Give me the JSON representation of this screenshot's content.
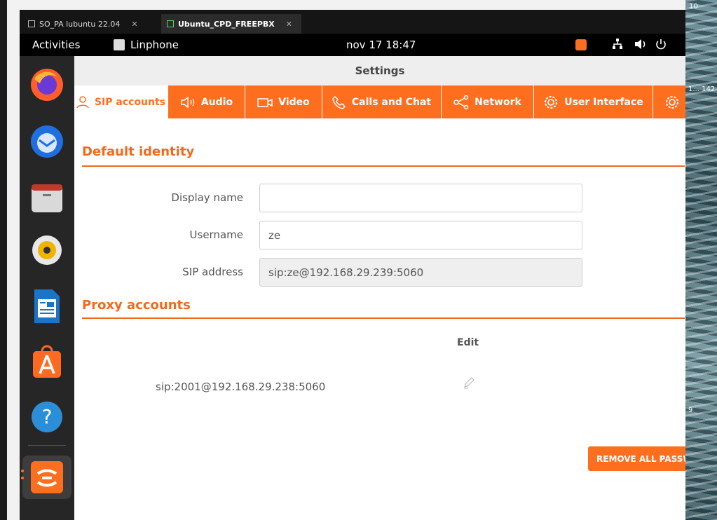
{
  "host": {
    "tabs": [
      {
        "label": "SO_PA lubuntu 22.04",
        "close": "✕"
      },
      {
        "label": "Ubuntu_CPD_FREEPBX",
        "close": "✕"
      }
    ],
    "wallpaper_labels": [
      "10",
      "1... 142",
      "9"
    ]
  },
  "topbar": {
    "activities": "Activities",
    "app_name": "Linphone",
    "clock": "nov 17  18:47"
  },
  "window": {
    "title": "Settings",
    "tabs": [
      {
        "label": "SIP accounts",
        "icon": "user-icon"
      },
      {
        "label": "Audio",
        "icon": "speaker-icon"
      },
      {
        "label": "Video",
        "icon": "camera-icon"
      },
      {
        "label": "Calls and Chat",
        "icon": "phone-icon"
      },
      {
        "label": "Network",
        "icon": "share-icon"
      },
      {
        "label": "User Interface",
        "icon": "gear-icon"
      },
      {
        "label": "",
        "icon": "gear-icon"
      }
    ]
  },
  "default_identity": {
    "title": "Default identity",
    "display_name_label": "Display name",
    "display_name_value": "",
    "username_label": "Username",
    "username_value": "ze",
    "sip_address_label": "SIP address",
    "sip_address_value": "sip:ze@192.168.29.239:5060"
  },
  "proxy_accounts": {
    "title": "Proxy accounts",
    "edit_header": "Edit",
    "accounts": [
      {
        "address": "sip:2001@192.168.29.238:5060"
      }
    ],
    "remove_all_label": "REMOVE ALL PASSW"
  },
  "colors": {
    "accent": "#fe6e1f",
    "dock": "#262626",
    "topbar": "#000000"
  }
}
